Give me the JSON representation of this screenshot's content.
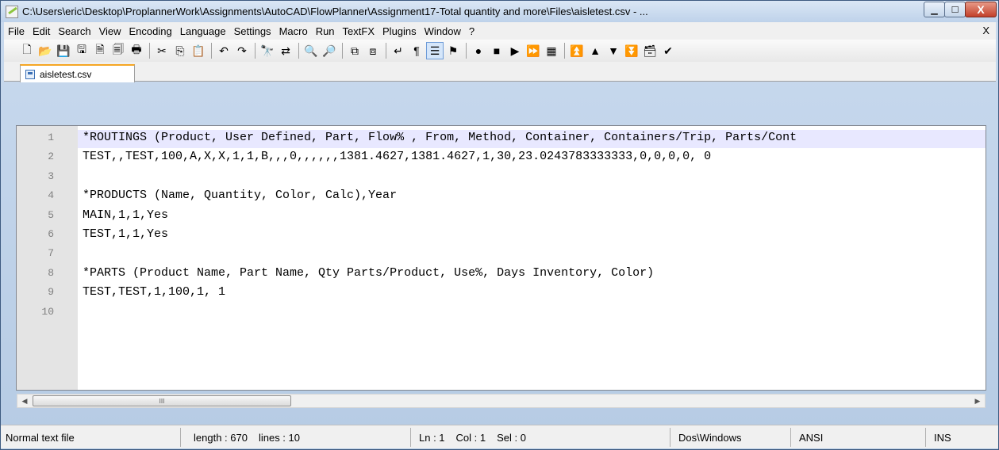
{
  "window": {
    "title": "C:\\Users\\eric\\Desktop\\ProplannerWork\\Assignments\\AutoCAD\\FlowPlanner\\Assignment17-Total quantity and more\\Files\\aisletest.csv - ...",
    "minimize_glyph": "▁",
    "maximize_glyph": "☐",
    "close_glyph": "X"
  },
  "menubar": {
    "items": [
      "File",
      "Edit",
      "Search",
      "View",
      "Encoding",
      "Language",
      "Settings",
      "Macro",
      "Run",
      "TextFX",
      "Plugins",
      "Window",
      "?"
    ],
    "close_label": "X"
  },
  "toolbar": {
    "buttons": [
      {
        "name": "new-file-icon",
        "glyph": "🗋"
      },
      {
        "name": "open-file-icon",
        "glyph": "📂"
      },
      {
        "name": "save-icon",
        "glyph": "💾"
      },
      {
        "name": "save-all-icon",
        "glyph": "🖫"
      },
      {
        "name": "close-icon",
        "glyph": "🗎"
      },
      {
        "name": "close-all-icon",
        "glyph": "🗐"
      },
      {
        "name": "print-icon",
        "glyph": "🖶"
      },
      {
        "sep": true
      },
      {
        "name": "cut-icon",
        "glyph": "✂"
      },
      {
        "name": "copy-icon",
        "glyph": "⎘"
      },
      {
        "name": "paste-icon",
        "glyph": "📋"
      },
      {
        "sep": true
      },
      {
        "name": "undo-icon",
        "glyph": "↶"
      },
      {
        "name": "redo-icon",
        "glyph": "↷"
      },
      {
        "sep": true
      },
      {
        "name": "find-icon",
        "glyph": "🔭"
      },
      {
        "name": "replace-icon",
        "glyph": "⇄"
      },
      {
        "sep": true
      },
      {
        "name": "zoom-in-icon",
        "glyph": "🔍"
      },
      {
        "name": "zoom-out-icon",
        "glyph": "🔎"
      },
      {
        "sep": true
      },
      {
        "name": "sync-vertical-icon",
        "glyph": "⧉"
      },
      {
        "name": "sync-horizontal-icon",
        "glyph": "⧈"
      },
      {
        "sep": true
      },
      {
        "name": "word-wrap-icon",
        "glyph": "↵"
      },
      {
        "name": "show-all-chars-icon",
        "glyph": "¶"
      },
      {
        "name": "indent-guide-icon",
        "glyph": "☰",
        "active": true
      },
      {
        "name": "user-language-icon",
        "glyph": "⚑"
      },
      {
        "sep": true
      },
      {
        "name": "record-macro-icon",
        "glyph": "●"
      },
      {
        "name": "stop-macro-icon",
        "glyph": "■"
      },
      {
        "name": "play-macro-icon",
        "glyph": "▶"
      },
      {
        "name": "run-macro-multiple-icon",
        "glyph": "⏩"
      },
      {
        "name": "save-macro-icon",
        "glyph": "▦"
      },
      {
        "sep": true
      },
      {
        "name": "move-top-icon",
        "glyph": "⏫"
      },
      {
        "name": "move-up-icon",
        "glyph": "▲"
      },
      {
        "name": "move-down-icon",
        "glyph": "▼"
      },
      {
        "name": "move-bottom-icon",
        "glyph": "⏬"
      },
      {
        "name": "clipboard-icon",
        "glyph": "🗃"
      },
      {
        "name": "spell-check-icon",
        "glyph": "✔"
      }
    ]
  },
  "tab": {
    "label": "aisletest.csv"
  },
  "editor": {
    "lines": [
      {
        "num": "1",
        "text": "*ROUTINGS (Product, User Defined, Part, Flow% , From, Method, Container, Containers/Trip, Parts/Cont"
      },
      {
        "num": "2",
        "text": "TEST,,TEST,100,A,X,X,1,1,B,,,0,,,,,,1381.4627,1381.4627,1,30,23.0243783333333,0,0,0,0, 0"
      },
      {
        "num": "3",
        "text": ""
      },
      {
        "num": "4",
        "text": "*PRODUCTS (Name, Quantity, Color, Calc),Year"
      },
      {
        "num": "5",
        "text": "MAIN,1,1,Yes"
      },
      {
        "num": "6",
        "text": "TEST,1,1,Yes"
      },
      {
        "num": "7",
        "text": ""
      },
      {
        "num": "8",
        "text": "*PARTS (Product Name, Part Name, Qty Parts/Product, Use%, Days Inventory, Color)"
      },
      {
        "num": "9",
        "text": "TEST,TEST,1,100,1, 1"
      },
      {
        "num": "10",
        "text": ""
      }
    ],
    "current_line_color": "#e8e8ff"
  },
  "hscroll": {
    "left_arrow": "◀",
    "right_arrow": "▶",
    "thumb_grip": "III"
  },
  "statusbar": {
    "file_type": "Normal text file",
    "length": "length : 670",
    "lines": "lines : 10",
    "ln": "Ln : 1",
    "col": "Col : 1",
    "sel": "Sel : 0",
    "eol": "Dos\\Windows",
    "encoding": "ANSI",
    "mode": "INS"
  }
}
